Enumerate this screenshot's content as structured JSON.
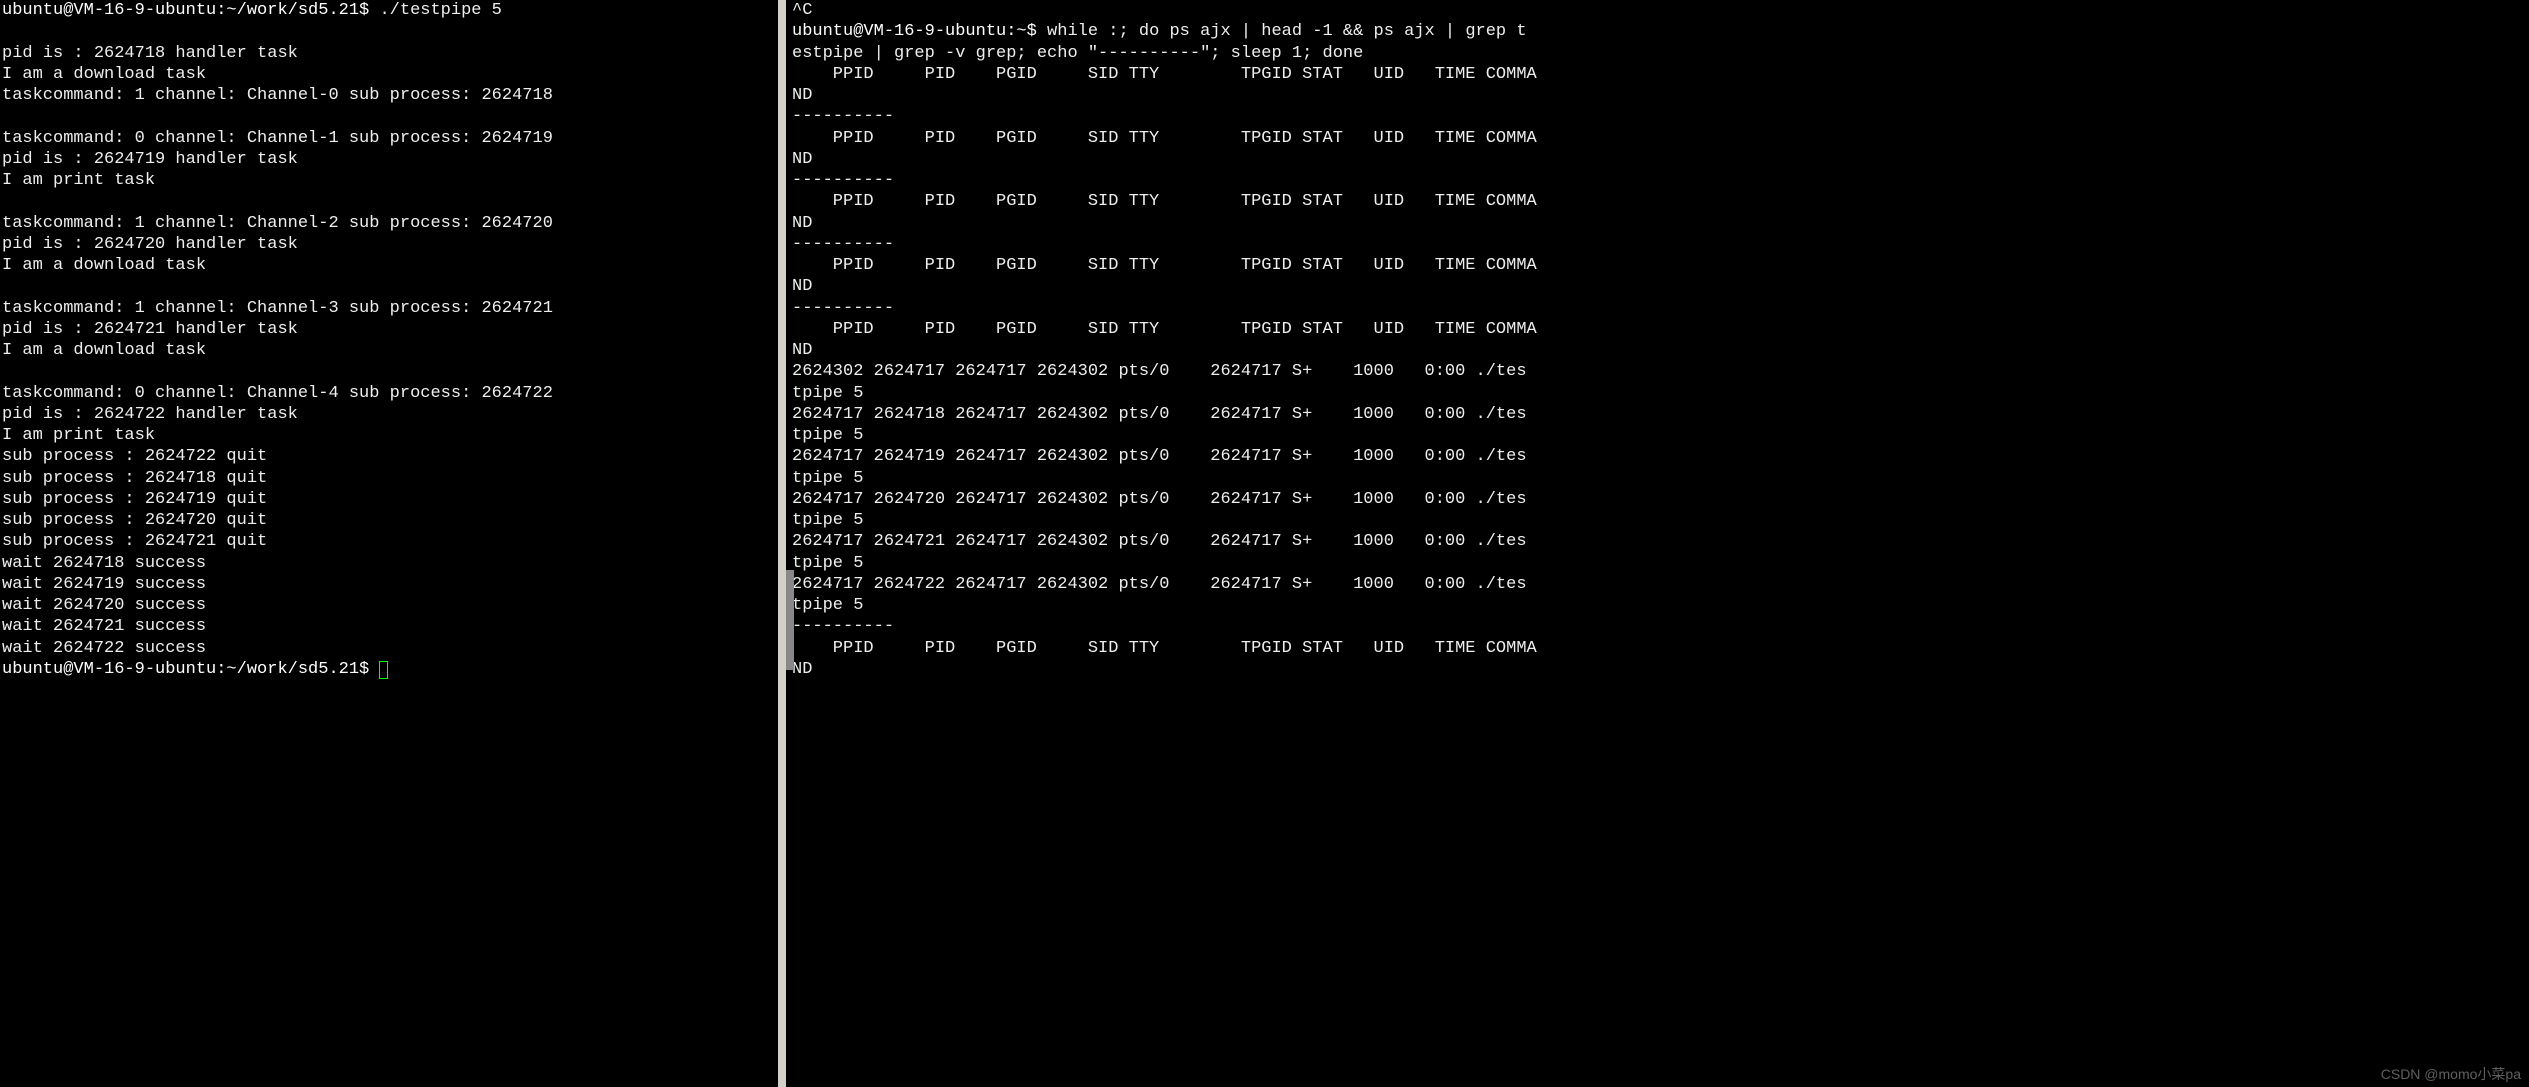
{
  "left_pane": {
    "prompt1": "ubuntu@VM-16-9-ubuntu:~/work/sd5.21$ ",
    "cmd1": "./testpipe 5",
    "lines": [
      "",
      "pid is : 2624718 handler task",
      "I am a download task",
      "taskcommand: 1 channel: Channel-0 sub process: 2624718",
      "",
      "taskcommand: 0 channel: Channel-1 sub process: 2624719",
      "pid is : 2624719 handler task",
      "I am print task",
      "",
      "taskcommand: 1 channel: Channel-2 sub process: 2624720",
      "pid is : 2624720 handler task",
      "I am a download task",
      "",
      "taskcommand: 1 channel: Channel-3 sub process: 2624721",
      "pid is : 2624721 handler task",
      "I am a download task",
      "",
      "taskcommand: 0 channel: Channel-4 sub process: 2624722",
      "pid is : 2624722 handler task",
      "I am print task",
      "sub process : 2624722 quit",
      "sub process : 2624718 quit",
      "sub process : 2624719 quit",
      "sub process : 2624720 quit",
      "sub process : 2624721 quit",
      "wait 2624718 success",
      "wait 2624719 success",
      "wait 2624720 success",
      "wait 2624721 success",
      "wait 2624722 success"
    ],
    "prompt2": "ubuntu@VM-16-9-ubuntu:~/work/sd5.21$ "
  },
  "right_pane": {
    "interrupt": "^C",
    "prompt": "ubuntu@VM-16-9-ubuntu:~$ ",
    "cmd_l1": "while :; do ps ajx | head -1 && ps ajx | grep t",
    "cmd_l2": "estpipe | grep -v grep; echo \"----------\"; sleep 1; done",
    "header": "    PPID     PID    PGID     SID TTY        TPGID STAT   UID   TIME COMMA",
    "header_wrap": "ND",
    "sep": "----------",
    "proc_rows": [
      {
        "row": "2624302 2624717 2624717 2624302 pts/0    2624717 S+    1000   0:00 ./tes",
        "wrap": "tpipe 5"
      },
      {
        "row": "2624717 2624718 2624717 2624302 pts/0    2624717 S+    1000   0:00 ./tes",
        "wrap": "tpipe 5"
      },
      {
        "row": "2624717 2624719 2624717 2624302 pts/0    2624717 S+    1000   0:00 ./tes",
        "wrap": "tpipe 5"
      },
      {
        "row": "2624717 2624720 2624717 2624302 pts/0    2624717 S+    1000   0:00 ./tes",
        "wrap": "tpipe 5"
      },
      {
        "row": "2624717 2624721 2624717 2624302 pts/0    2624717 S+    1000   0:00 ./tes",
        "wrap": "tpipe 5"
      },
      {
        "row": "2624717 2624722 2624717 2624302 pts/0    2624717 S+    1000   0:00 ./tes",
        "wrap": "tpipe 5"
      }
    ]
  },
  "watermark": "CSDN @momo小菜pa"
}
